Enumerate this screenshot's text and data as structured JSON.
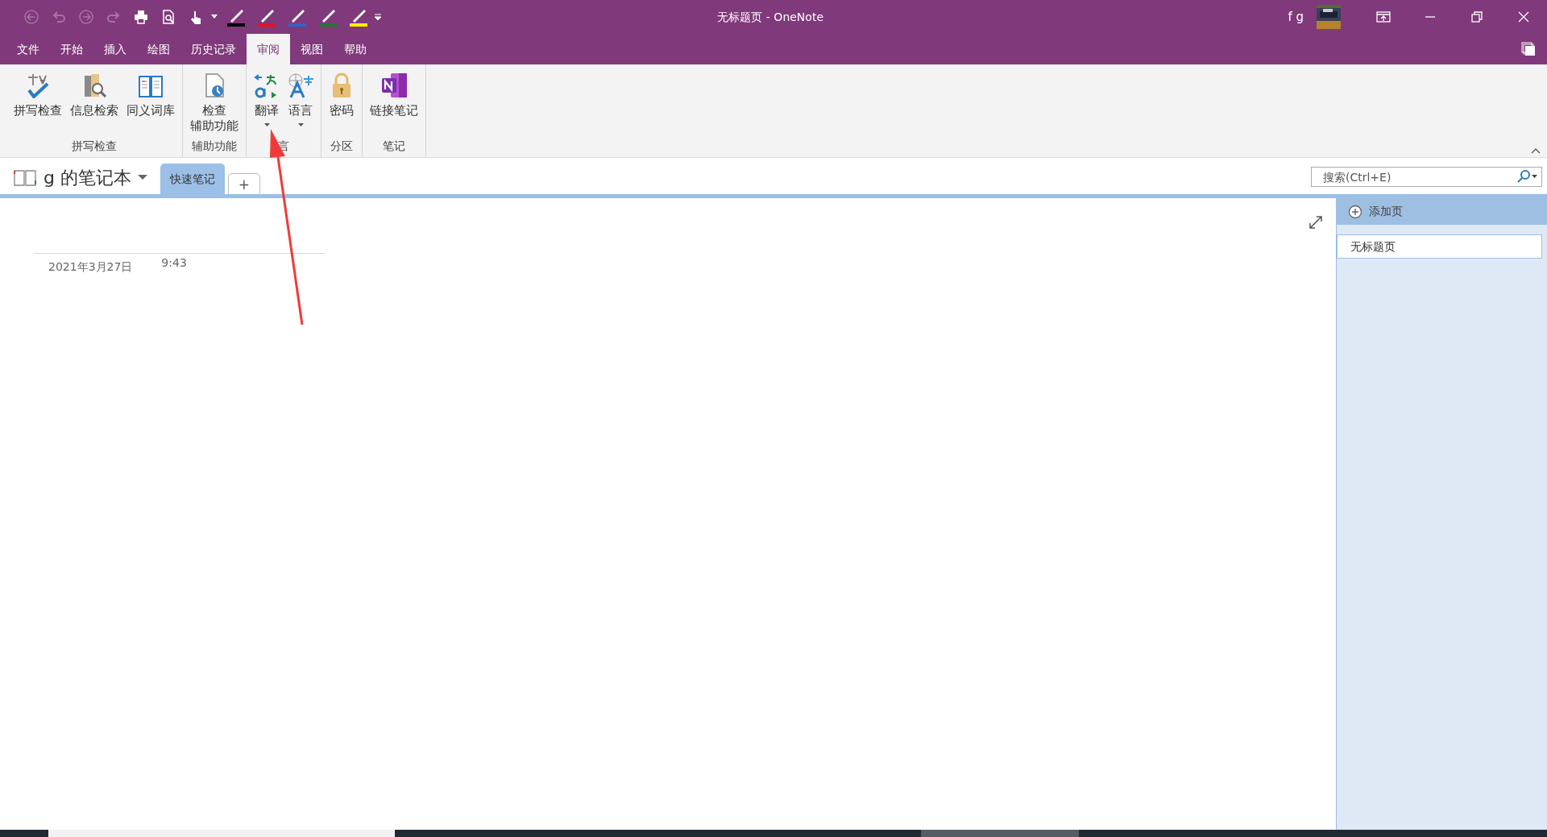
{
  "quick_access": [
    {
      "kind": "back",
      "disabled": true
    },
    {
      "kind": "undo",
      "disabled": true
    },
    {
      "kind": "forward",
      "disabled": true
    },
    {
      "kind": "redo",
      "disabled": true
    },
    {
      "kind": "print",
      "disabled": false
    },
    {
      "kind": "preview",
      "disabled": false
    },
    {
      "kind": "touch",
      "disabled": false
    }
  ],
  "pens": [
    {
      "color": "#000000"
    },
    {
      "color": "#e81123"
    },
    {
      "color": "#2f64c8"
    },
    {
      "color": "#1e7a2e"
    },
    {
      "color": "#fff200"
    }
  ],
  "window": {
    "title": "无标题页 - OneNote",
    "account": "f g"
  },
  "menu_tabs": [
    {
      "label": "文件",
      "selected": false
    },
    {
      "label": "开始",
      "selected": false
    },
    {
      "label": "插入",
      "selected": false
    },
    {
      "label": "绘图",
      "selected": false
    },
    {
      "label": "历史记录",
      "selected": false
    },
    {
      "label": "审阅",
      "selected": true
    },
    {
      "label": "视图",
      "selected": false
    },
    {
      "label": "帮助",
      "selected": false
    }
  ],
  "ribbon_groups": [
    {
      "label": "拼写检查",
      "buttons": [
        {
          "kind": "spell",
          "label": "拼写检查",
          "dropdown": false
        },
        {
          "kind": "research",
          "label": "信息检索",
          "dropdown": false
        },
        {
          "kind": "thesaurus",
          "label": "同义词库",
          "dropdown": false
        }
      ]
    },
    {
      "label": "辅助功能",
      "buttons": [
        {
          "kind": "accessibility",
          "label_lines": [
            "检查",
            "辅助功能"
          ],
          "dropdown": false
        }
      ]
    },
    {
      "label": "言",
      "buttons": [
        {
          "kind": "translate",
          "label": "翻译",
          "dropdown": true
        },
        {
          "kind": "language",
          "label": "语言",
          "dropdown": true
        }
      ]
    },
    {
      "label": "分区",
      "buttons": [
        {
          "kind": "password",
          "label": "密码",
          "dropdown": false
        }
      ]
    },
    {
      "label": "笔记",
      "buttons": [
        {
          "kind": "onenote",
          "label": "链接笔记",
          "dropdown": false
        }
      ]
    }
  ],
  "notebook": {
    "name": "g 的笔记本",
    "sections": [
      {
        "label": "快速笔记",
        "selected": true
      }
    ],
    "add_section": "+"
  },
  "search": {
    "placeholder": "搜索(Ctrl+E)"
  },
  "page": {
    "date": "2021年3月27日",
    "time": "9:43"
  },
  "page_pane": {
    "add_page": "添加页",
    "pages": [
      {
        "title": "无标题页",
        "selected": true
      }
    ]
  }
}
